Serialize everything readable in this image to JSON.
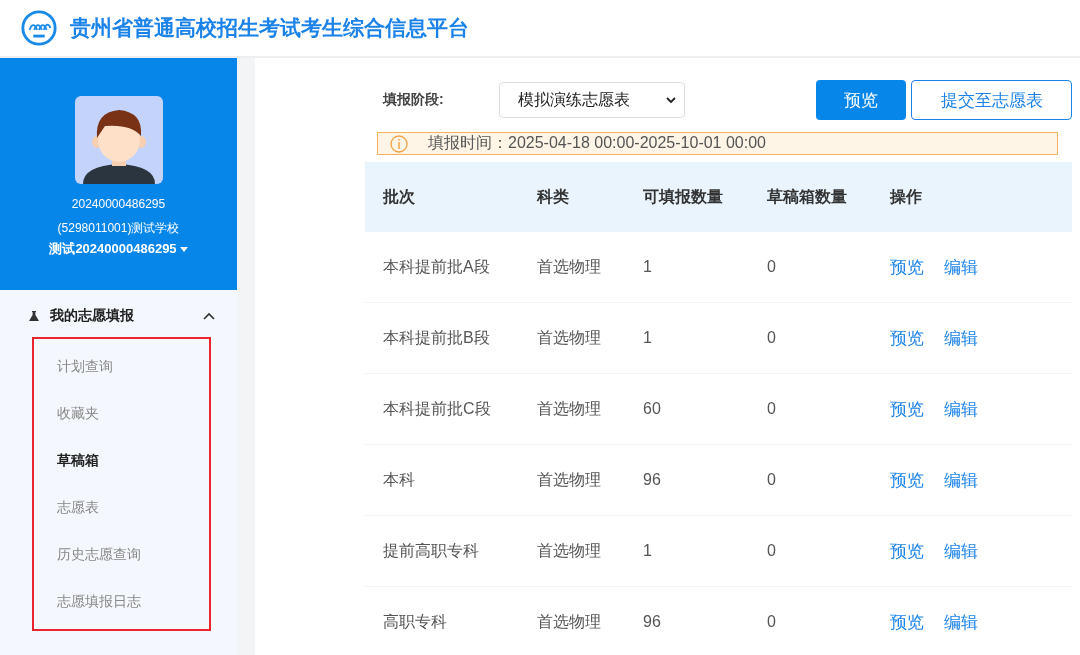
{
  "header": {
    "title": "贵州省普通高校招生考试考生综合信息平台"
  },
  "sidebar": {
    "user": {
      "id": "20240000486295",
      "school": "(5298011001)测试学校",
      "name": "测试20240000486295"
    },
    "menu": {
      "label": "我的志愿填报",
      "expanded": true,
      "items": [
        {
          "label": "计划查询",
          "selected": false
        },
        {
          "label": "收藏夹",
          "selected": false
        },
        {
          "label": "草稿箱",
          "selected": true
        },
        {
          "label": "志愿表",
          "selected": false
        },
        {
          "label": "历史志愿查询",
          "selected": false
        },
        {
          "label": "志愿填报日志",
          "selected": false
        }
      ]
    }
  },
  "toolbar": {
    "stage_label": "填报阶段:",
    "stage": "模拟演练志愿表",
    "buttons": [
      {
        "label": "预览",
        "kind": "primary"
      },
      {
        "label": "提交至志愿表",
        "kind": "outline"
      }
    ]
  },
  "notice": "填报时间：2025-04-18 00:00-2025-10-01 00:00",
  "table": {
    "columns": [
      "批次",
      "科类",
      "可填报数量",
      "草稿箱数量",
      "操作"
    ],
    "rows": [
      {
        "batch": "本科提前批A段",
        "subject": "首选物理",
        "available": "1",
        "drafts": "0",
        "actions": [
          "预览",
          "编辑"
        ]
      },
      {
        "batch": "本科提前批B段",
        "subject": "首选物理",
        "available": "1",
        "drafts": "0",
        "actions": [
          "预览",
          "编辑"
        ]
      },
      {
        "batch": "本科提前批C段",
        "subject": "首选物理",
        "available": "60",
        "drafts": "0",
        "actions": [
          "预览",
          "编辑"
        ]
      },
      {
        "batch": "本科",
        "subject": "首选物理",
        "available": "96",
        "drafts": "0",
        "actions": [
          "预览",
          "编辑"
        ]
      },
      {
        "batch": "提前高职专科",
        "subject": "首选物理",
        "available": "1",
        "drafts": "0",
        "actions": [
          "预览",
          "编辑"
        ]
      },
      {
        "batch": "高职专科",
        "subject": "首选物理",
        "available": "96",
        "drafts": "0",
        "actions": [
          "预览",
          "编辑"
        ]
      }
    ]
  }
}
